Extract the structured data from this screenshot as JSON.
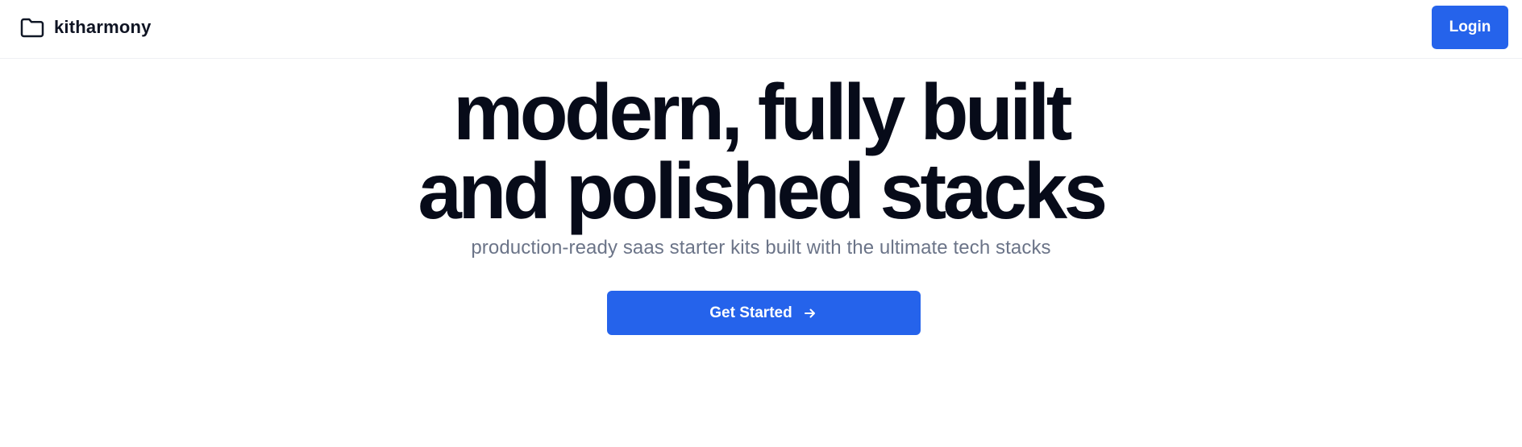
{
  "header": {
    "brand_icon": "folder-icon",
    "brand_name": "kitharmony",
    "login_label": "Login"
  },
  "hero": {
    "headline_line1": "modern, fully built",
    "headline_line2": "and polished stacks",
    "subtitle": "production-ready saas starter kits built with the ultimate tech stacks",
    "cta_label": "Get Started",
    "cta_icon": "arrow-right-icon"
  },
  "colors": {
    "accent": "#2563eb",
    "headline": "#070b19",
    "subtitle": "#6b7488",
    "background": "#ffffff"
  }
}
